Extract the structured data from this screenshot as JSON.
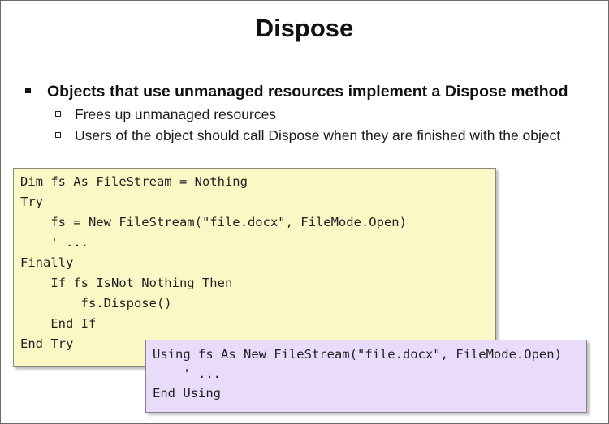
{
  "slide": {
    "title": "Dispose",
    "bullet": "Objects that use unmanaged resources implement a Dispose method",
    "sub_bullets": [
      "Frees up unmanaged resources",
      "Users of the object should call Dispose when they are finished with the object"
    ]
  },
  "code_finally": [
    "Dim fs As FileStream = Nothing",
    "Try",
    "    fs = New FileStream(\"file.docx\", FileMode.Open)",
    "    ' ...",
    "Finally",
    "    If fs IsNot Nothing Then",
    "        fs.Dispose()",
    "    End If",
    "End Try"
  ],
  "code_using": [
    "Using fs As New FileStream(\"file.docx\", FileMode.Open)",
    "    ' ...",
    "End Using"
  ],
  "colors": {
    "code_finally_background": "#fcf8c5",
    "code_using_background": "#e8dcfa"
  }
}
